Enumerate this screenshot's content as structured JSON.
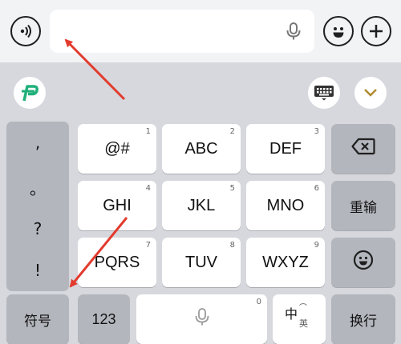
{
  "input_bar": {
    "voice_icon": "voice-wave-icon",
    "mic_icon": "microphone-icon",
    "emoji_icon": "emoji-smile-icon",
    "add_icon": "plus-icon"
  },
  "toolbar": {
    "logo_icon": "input-method-logo-icon",
    "keyboard_icon": "keyboard-icon",
    "collapse_icon": "chevron-down-icon"
  },
  "punctuation": [
    ",",
    "。",
    "?",
    "!"
  ],
  "keys": {
    "row1": [
      {
        "label": "@#",
        "sub": "1"
      },
      {
        "label": "ABC",
        "sub": "2"
      },
      {
        "label": "DEF",
        "sub": "3"
      }
    ],
    "row2": [
      {
        "label": "GHI",
        "sub": "4"
      },
      {
        "label": "JKL",
        "sub": "5"
      },
      {
        "label": "MNO",
        "sub": "6"
      }
    ],
    "row3": [
      {
        "label": "PQRS",
        "sub": "7"
      },
      {
        "label": "TUV",
        "sub": "8"
      },
      {
        "label": "WXYZ",
        "sub": "9"
      }
    ],
    "delete_icon": "backspace-icon",
    "retype_label": "重输",
    "emoji_key_icon": "emoji-smile-icon",
    "symbols_label": "符号",
    "numbers_label": "123",
    "space_sub": "0",
    "space_icon": "microphone-icon",
    "lang_main": "中",
    "lang_alt": "英",
    "enter_label": "换行"
  },
  "colors": {
    "background": "#d6d8dd",
    "function_key": "#b3b6bd",
    "letter_key": "#ffffff",
    "arrow": "#e23b2e",
    "logo": "#20b07a"
  }
}
